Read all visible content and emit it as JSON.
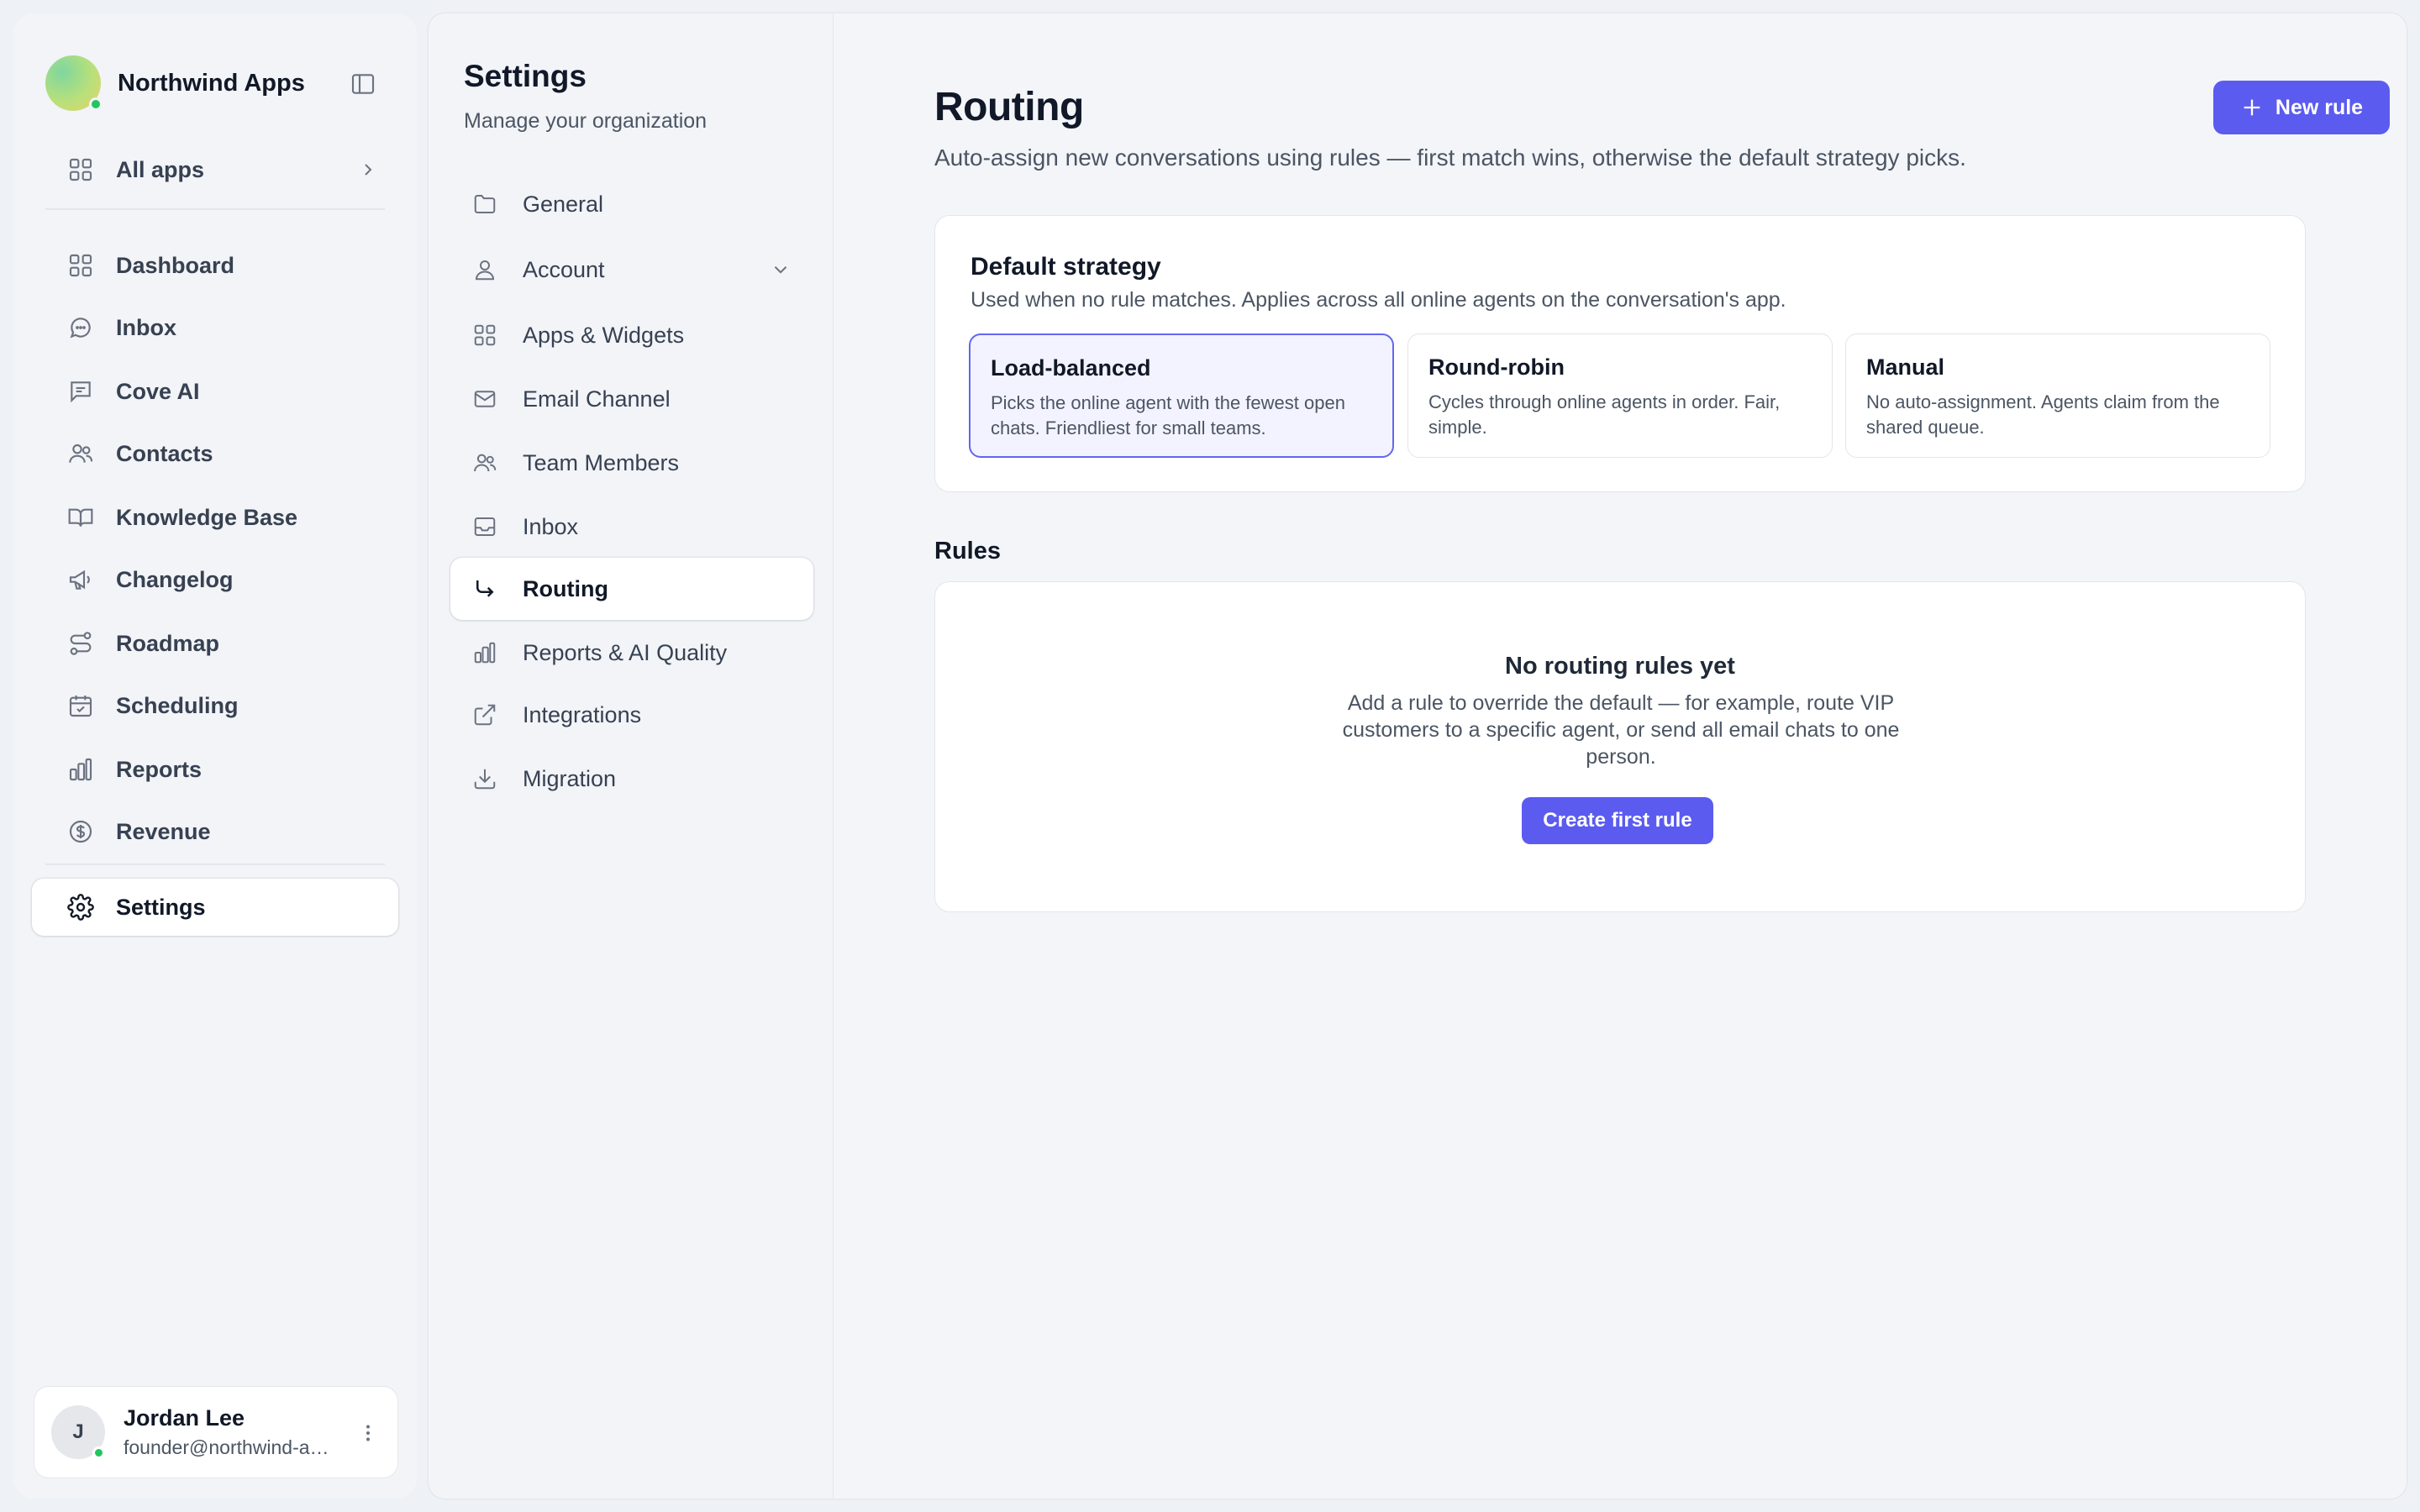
{
  "app": {
    "brand_name": "Northwind Apps",
    "all_apps_label": "All apps",
    "nav": [
      {
        "label": "Dashboard",
        "icon": "grid-icon"
      },
      {
        "label": "Inbox",
        "icon": "chat-bubble-icon"
      },
      {
        "label": "Cove AI",
        "icon": "message-square-icon"
      },
      {
        "label": "Contacts",
        "icon": "users-icon"
      },
      {
        "label": "Knowledge Base",
        "icon": "book-icon"
      },
      {
        "label": "Changelog",
        "icon": "megaphone-icon"
      },
      {
        "label": "Roadmap",
        "icon": "route-icon"
      },
      {
        "label": "Scheduling",
        "icon": "calendar-check-icon"
      },
      {
        "label": "Reports",
        "icon": "bar-chart-icon"
      },
      {
        "label": "Revenue",
        "icon": "dollar-circle-icon"
      }
    ],
    "settings_label": "Settings",
    "user": {
      "initial": "J",
      "name": "Jordan Lee",
      "email": "founder@northwind-apps.com"
    }
  },
  "settings": {
    "title": "Settings",
    "subtitle": "Manage your organization",
    "items": [
      {
        "label": "General",
        "icon": "folder-icon"
      },
      {
        "label": "Account",
        "icon": "user-icon"
      },
      {
        "label": "Apps & Widgets",
        "icon": "grid-icon"
      },
      {
        "label": "Email Channel",
        "icon": "mail-icon"
      },
      {
        "label": "Team Members",
        "icon": "users-icon"
      },
      {
        "label": "Inbox",
        "icon": "inbox-tray-icon"
      },
      {
        "label": "Routing",
        "icon": "corner-down-right-icon",
        "active": true
      },
      {
        "label": "Reports & AI Quality",
        "icon": "bar-chart-icon"
      },
      {
        "label": "Integrations",
        "icon": "external-link-icon"
      },
      {
        "label": "Migration",
        "icon": "download-icon"
      }
    ]
  },
  "routing": {
    "title": "Routing",
    "description": "Auto-assign new conversations using rules — first match wins, otherwise the default strategy picks.",
    "new_rule_label": "New rule",
    "default_strategy": {
      "title": "Default strategy",
      "subtitle": "Used when no rule matches. Applies across all online agents on the conversation's app.",
      "options": [
        {
          "title": "Load-balanced",
          "desc": "Picks the online agent with the fewest open chats. Friendliest for small teams.",
          "selected": true
        },
        {
          "title": "Round-robin",
          "desc": "Cycles through online agents in order. Fair, simple.",
          "selected": false
        },
        {
          "title": "Manual",
          "desc": "No auto-assignment. Agents claim from the shared queue.",
          "selected": false
        }
      ]
    },
    "rules": {
      "heading": "Rules",
      "empty_title": "No routing rules yet",
      "empty_desc": "Add a rule to override the default — for example, route VIP customers to a specific agent, or send all email chats to one person.",
      "create_label": "Create first rule"
    }
  },
  "colors": {
    "accent": "#5b5bf0",
    "selected_border": "#6366f1",
    "online": "#22c55e"
  }
}
